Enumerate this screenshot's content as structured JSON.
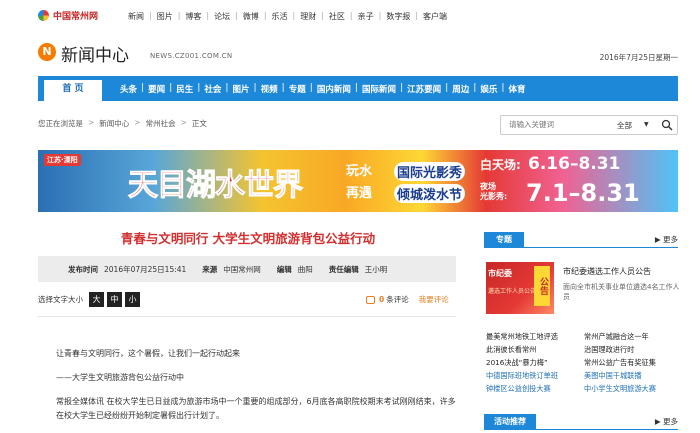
{
  "site": {
    "logo_text": "中国常州网"
  },
  "topnav": [
    "新闻",
    "图片",
    "博客",
    "论坛",
    "微博",
    "乐活",
    "理财",
    "社区",
    "亲子",
    "数字报",
    "客户端"
  ],
  "section": {
    "badge": "N",
    "title": "新闻中心",
    "domain": "NEWS.CZ001.COM.CN",
    "date": "2016年7月25日星期一"
  },
  "mainnav": {
    "home": "首  页",
    "links": [
      "头条",
      "要闻",
      "民生",
      "社会",
      "图片",
      "视频",
      "专题",
      "国内新闻",
      "国际新闻",
      "江苏要闻",
      "周边",
      "娱乐",
      "体育"
    ]
  },
  "breadcrumb": [
    "您正在浏览是",
    "新闻中心",
    "常州社会",
    "正文"
  ],
  "search": {
    "placeholder": "请输入关键词",
    "scope": "全部"
  },
  "banner": {
    "tag": "江苏·溧阳",
    "big": "天目湖水世界",
    "mid1": "玩水",
    "mid2": "再遇",
    "mid3": "国际光影秀",
    "mid4": "倾城泼水节",
    "r1": "白天场:",
    "r2": "6.16–8.31",
    "r3a": "夜场",
    "r3b": "光影秀:",
    "r4": "7.1–8.31"
  },
  "article": {
    "title": "青春与文明同行 大学生文明旅游背包公益行动",
    "meta": {
      "time_label": "发布时间",
      "time": "2016年07月25日15:41",
      "source_label": "来源",
      "source": "中国常州网",
      "editor_label": "编辑",
      "editor": "曲阳",
      "chief_label": "责任编辑",
      "chief": "王小明"
    },
    "font_label": "选择文字大小",
    "font_sizes": [
      "大",
      "中",
      "小"
    ],
    "comments_count": "0",
    "comments_label": "条评论",
    "comment_link": "我要评论",
    "paragraphs": [
      "让青春与文明同行，这个暑假，让我们一起行动起来",
      "——大学生文明旅游背包公益行动中",
      "常报全媒体讯 在校大学生已日益成为旅游市场中一个重要的组成部分，6月底各高职院校期末考试刚刚结束，许多在校大学生已经纷纷开始制定暑假出行计划了。"
    ]
  },
  "sidebar": {
    "tab": "专题",
    "more": "更多",
    "image_title": "市纪委",
    "image_sub": "遴选工作人员公告",
    "image_tag": "公告",
    "headline": "市纪委遴选工作人员公告",
    "summary": "面向全市机关事业单位遴选4名工作人员",
    "links": [
      {
        "text": "最美常州地铁工地评选",
        "color": "dark"
      },
      {
        "text": "常州产城融合这一年",
        "color": "dark"
      },
      {
        "text": "此消彼长看常州",
        "color": "dark"
      },
      {
        "text": "治国理政进行时",
        "color": "dark"
      },
      {
        "text": "2016决战“暴力梅”",
        "color": "dark"
      },
      {
        "text": "常州公益广告有奖征集",
        "color": "dark"
      },
      {
        "text": "中德国际班地铁订单班",
        "color": "blue"
      },
      {
        "text": "美图中国千城联播",
        "color": "blue"
      },
      {
        "text": "钟楼区公益创投大赛",
        "color": "blue"
      },
      {
        "text": "中小学生文明旅游大赛",
        "color": "blue"
      }
    ],
    "tab2": "活动推荐",
    "more2": "更多"
  }
}
